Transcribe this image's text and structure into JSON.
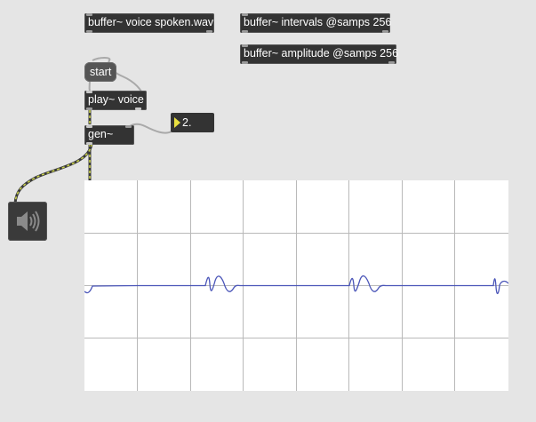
{
  "objects": {
    "buffer_voice": "buffer~ voice spoken.wav",
    "buffer_intervals": "buffer~ intervals @samps 256",
    "buffer_amplitude": "buffer~ amplitude @samps 256",
    "start_message": "start",
    "play_voice": "play~ voice",
    "gen": "gen~",
    "number_value": "2."
  },
  "icons": {
    "number_triangle": "play-triangle-icon",
    "speaker": "speaker-icon"
  },
  "colors": {
    "background": "#e5e5e5",
    "object_fill": "#333333",
    "message_fill": "#555555",
    "number_triangle": "#e9e040",
    "signal_cord": "#c8d04a",
    "scope_background": "#ffffff",
    "scope_grid": "#b9b9b9",
    "scope_trace": "#4a55b8"
  }
}
